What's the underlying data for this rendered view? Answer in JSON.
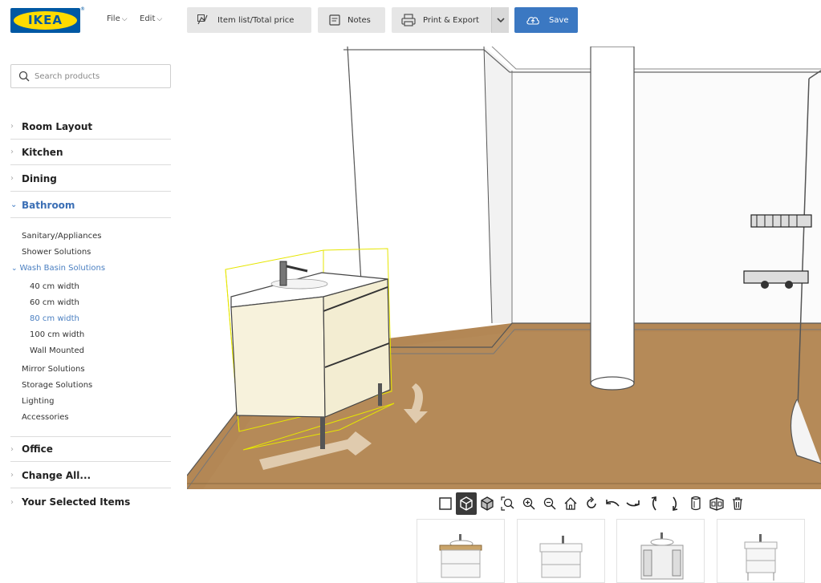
{
  "brand": {
    "logo_text": "IKEA",
    "reg_mark": "®"
  },
  "menu": {
    "file": "File",
    "edit": "Edit"
  },
  "toolbar": {
    "item_list_label": "Item list/Total price",
    "notes_label": "Notes",
    "print_export_label": "Print & Export",
    "save_label": "Save"
  },
  "search": {
    "placeholder": "Search products",
    "value": ""
  },
  "sidebar": {
    "categories": [
      {
        "label": "Room Layout"
      },
      {
        "label": "Kitchen"
      },
      {
        "label": "Dining"
      },
      {
        "label": "Bathroom"
      },
      {
        "label": "Office"
      },
      {
        "label": "Change All..."
      },
      {
        "label": "Your Selected Items"
      }
    ],
    "bathroom_items": [
      {
        "label": "Sanitary/Appliances"
      },
      {
        "label": "Shower Solutions"
      },
      {
        "label": "Wash Basin Solutions"
      },
      {
        "label": "Mirror Solutions"
      },
      {
        "label": "Storage Solutions"
      },
      {
        "label": "Lighting"
      },
      {
        "label": "Accessories"
      }
    ],
    "wash_basin_items": [
      {
        "label": "40 cm width"
      },
      {
        "label": "60 cm width"
      },
      {
        "label": "80 cm width"
      },
      {
        "label": "100 cm width"
      },
      {
        "label": "Wall Mounted"
      }
    ],
    "selected_category": "Bathroom",
    "selected_sub": "80 cm width"
  },
  "view_tools": [
    "2d-view-icon",
    "3d-view-icon",
    "3d-solid-view-icon",
    "zoom-fit-icon",
    "zoom-in-icon",
    "zoom-out-icon",
    "home-view-icon",
    "rotate-icon",
    "rotate-left-icon",
    "rotate-right-icon",
    "tilt-up-icon",
    "tilt-down-icon",
    "wall-cutaway-icon",
    "room-view-icon",
    "delete-icon"
  ],
  "colors": {
    "accent": "#3b78c2",
    "save_bg": "#3b78c2",
    "floor": "#b38755",
    "toolbar_btn": "#e6e6e6",
    "active_link": "#4a7fc1"
  }
}
